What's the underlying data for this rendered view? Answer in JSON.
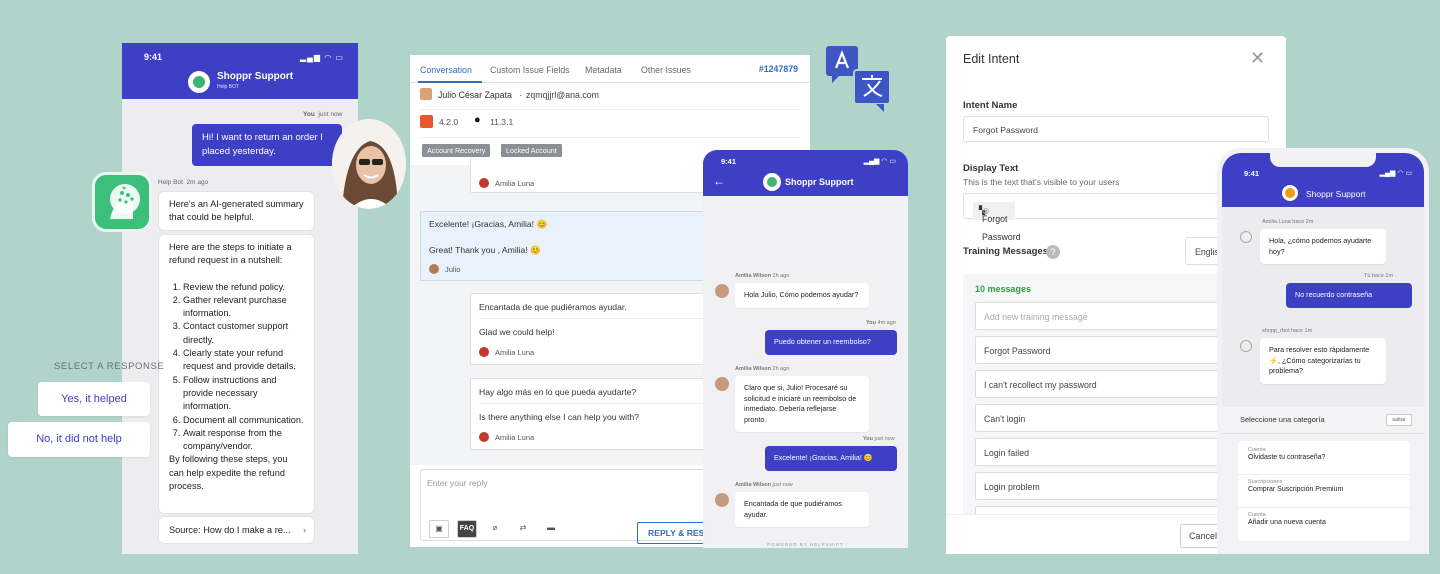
{
  "colors": {
    "background": "#b1d4ca",
    "brand": "#3d3fc4",
    "accent_blue": "#2f6cc4",
    "success_green": "#2f9e3f"
  },
  "panel1": {
    "time": "9:41",
    "bot_name": "Shoppr Support",
    "bot_subtitle": "Help BOT",
    "user_meta_name": "You",
    "user_meta_time": "just now",
    "user_message": "Hi! I want to return an order I placed yesterday.",
    "bot_meta_name": "Help Bot",
    "bot_meta_time": "2m ago",
    "summary_text": "Here's an AI-generated summary that could be helpful.",
    "steps_intro": "Here are the steps to initiate a refund request in a nutshell:",
    "steps": [
      "Review the refund policy.",
      "Gather relevant purchase information.",
      "Contact customer support directly.",
      "Clearly state your refund request and provide details.",
      "Follow instructions and provide necessary information.",
      "Document all communication.",
      "Await response from the company/vendor."
    ],
    "steps_outro": "By following these steps, you can help expedite the refund process.",
    "source_label": "Source: How do I make a re...",
    "select_header": "SELECT A RESPONSE",
    "option_yes": "Yes, it helped",
    "option_no": "No, it did not help"
  },
  "panel2": {
    "tabs": [
      "Conversation",
      "Custom Issue Fields",
      "Metadata",
      "Other Issues"
    ],
    "ticket_id": "#1247879",
    "customer_name": "Julio César Zapata",
    "customer_email": "zqmqjjrl@ana.com",
    "app_version": "4.2.0",
    "os_version": "11.3.1",
    "tags": [
      "Account Recovery",
      "Locked Account"
    ],
    "agent_name": "Amilia Luna",
    "customer_short": "Julio",
    "customer_msg_es": "Excelente! ¡Gracias, Amilia! 😊",
    "customer_msg_en": "Great! Thank you , Amilia! 😊",
    "agent_msg1_es": "Encantada de que pudiéramos ayudar.",
    "agent_msg1_en": "Glad we could help!",
    "agent_msg2_es": "Hay algo más en lo que pueda ayudarte?",
    "agent_msg2_en": "Is there anything else I can help you with?",
    "reply_placeholder": "Enter your reply",
    "faq_label": "FAQ",
    "resolve_label": "REPLY & RESOLVE"
  },
  "panel3": {
    "time": "9:41",
    "bot_name": "Shoppr Support",
    "agent": "Amilia Wilson",
    "time_2h": "2h ago",
    "you": "You",
    "time_4m": "4m ago",
    "time_now": "just now",
    "msg1": "Hola Julio, Cómo podemos ayudar?",
    "msg2": "Puedo obtener un reembolso?",
    "msg3": "Claro que si, Julio! Procesaré su solicitud e iniciaré un reembolso de inmediato. Debería reflejarse pronto.",
    "msg4": "Excelente! ¡Gracias, Amilia! 😊",
    "msg5": "Encantada de que pudiéramos ayudar.",
    "powered": "POWERED BY HELPSHIFT"
  },
  "panel4": {
    "title": "Edit Intent",
    "intent_name_label": "Intent Name",
    "intent_name_value": "Forgot Password",
    "display_text_label": "Display Text",
    "display_text_help": "This is the text that's visible to your users",
    "display_chip": "Forgot Password",
    "training_label": "Training Messages",
    "language": "Englis",
    "count": "10 messages",
    "add_placeholder": "Add new training message",
    "messages": [
      "Forgot Password",
      "I can't recollect my password",
      "Can't login",
      "Login failed",
      "Login problem"
    ],
    "cancel": "Cancel"
  },
  "panel5": {
    "time": "9:41",
    "bot_name": "Shoppr Support",
    "bot1_meta": "Amilia Luna  hace 2m",
    "bot1_msg": "Hola, ¿cómo podemos ayudarte hoy?",
    "user_meta": "Tú  hace 1m",
    "user_msg": "No recuerdo contraseña",
    "bot2_meta": "shopp_rbot  hace 1m",
    "bot2_msg": "Para resolver esto rápidamente ⚡, ¿Cómo categorizarías tu problema?",
    "category_title": "Seleccione una categoría",
    "skip": "saltar",
    "categories": [
      {
        "key": "Cuenta",
        "value": "Olvidaste tu contraseña?"
      },
      {
        "key": "Suscripciones",
        "value": "Comprar Suscripción Premium"
      },
      {
        "key": "Cuenta",
        "value": "Añadir una nueva cuenta"
      }
    ]
  }
}
